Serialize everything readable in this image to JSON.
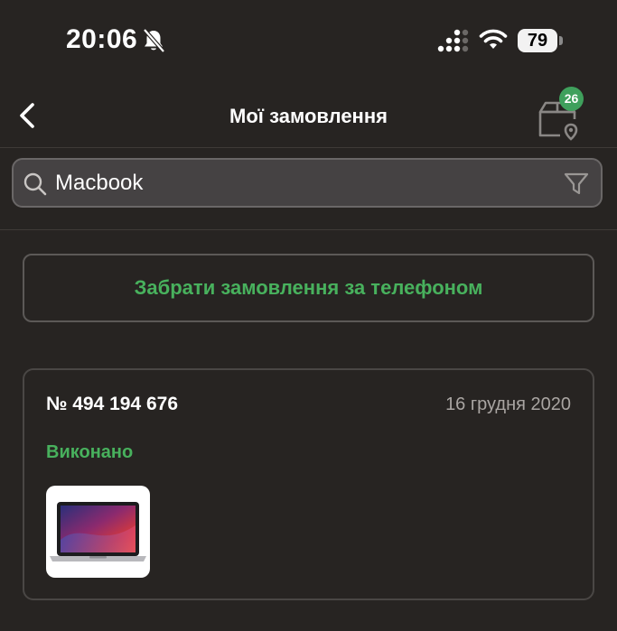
{
  "status_bar": {
    "time": "20:06",
    "battery": "79"
  },
  "header": {
    "title": "Мої замовлення",
    "delivery_badge": "26"
  },
  "search": {
    "value": "Macbook",
    "placeholder": ""
  },
  "pickup_button": {
    "label": "Забрати замовлення за телефоном"
  },
  "orders": [
    {
      "number": "№ 494 194 676",
      "date": "16 грудня 2020",
      "status": "Виконано"
    }
  ],
  "icons": {
    "back": "chevron-left-icon",
    "delivery": "box-location-icon",
    "search": "search-icon",
    "filter": "filter-icon",
    "bell_muted": "bell-slash-icon",
    "signal": "cellular-signal-icon",
    "wifi": "wifi-icon"
  },
  "colors": {
    "background": "#272422",
    "accent_green": "#48b15d",
    "badge_green": "#3fa05c",
    "search_bg": "#454243",
    "muted_text": "#a9a5a2"
  }
}
